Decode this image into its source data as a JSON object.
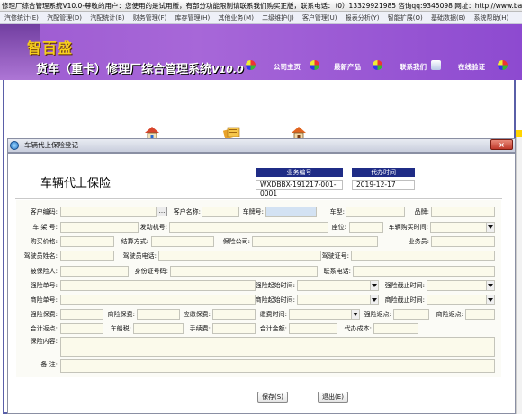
{
  "window": {
    "title": "修理厂综合管理系统V10.0-尊敬的用户：您使用的是试用版，有部分功能限制请联系我们购买正版，联系电话：（0）13329921985  咨询qq:9345098  网址：http://www.baishengsoft.com"
  },
  "menu": {
    "items": [
      "汽修统计(E)",
      "汽配管理(D)",
      "汽配统计(B)",
      "财务管理(F)",
      "库存管理(H)",
      "其他业务(M)",
      "二级维护(J)",
      "客户管理(U)",
      "报表分析(Y)",
      "智能扩展(O)",
      "基础数据(B)",
      "系统帮助(H)"
    ]
  },
  "banner": {
    "brand": "智百盛",
    "title": "货车（重卡）修理厂综合管理系统",
    "version": "V10.0",
    "links": [
      "公司主页",
      "最新产品",
      "联系我们",
      "在线验证"
    ],
    "colors": {
      "banner": "#9d5bd1",
      "brand": "#f6cf1e"
    }
  },
  "mdi_icons": [
    "house-icon",
    "document-stack-icon",
    "house-icon"
  ],
  "dialog": {
    "title": "车辆代上保险登记",
    "close_label": "×",
    "form_title": "车辆代上保险",
    "header": {
      "business_no_label": "业务编号",
      "business_no": "WXDBBX-191217-001-0001",
      "date_label": "代办时间",
      "date": "2019-12-17"
    },
    "fields": {
      "customer_code": "客户编码:",
      "customer_code_btn": "...",
      "customer_name": "客户名称:",
      "plate_no": "车牌号:",
      "car_type": "车型:",
      "brand": "品牌:",
      "vin": "车 架 号:",
      "engine_no": "发动机号:",
      "seats": "座位:",
      "purchase_date": "车辆购买时间:",
      "purchase_price": "购买价格:",
      "settlement": "结算方式:",
      "insurer": "保险公司:",
      "salesman": "业务员:",
      "driver_name": "驾驶员姓名:",
      "driver_phone": "驾驶员电话:",
      "driver_license": "驾驶证号:",
      "insured": "被保险人:",
      "id_no": "身份证号码:",
      "contact_phone": "联系电话:",
      "compulsory_policy_no": "强险单号:",
      "compulsory_start": "强险起始时间:",
      "compulsory_end": "强险截止时间:",
      "commercial_policy_no": "商险单号:",
      "commercial_start": "商险起始时间:",
      "commercial_end": "商险截止时间:",
      "compulsory_premium": "强险保费:",
      "commercial_premium": "商险保费:",
      "receivable_premium": "应缴保费:",
      "payment_time": "缴费时间:",
      "compulsory_rebate": "强险返点:",
      "commercial_rebate": "商险返点:",
      "total_rebate": "合计返点:",
      "vehicle_tax": "车船税:",
      "handling_fee": "手续费:",
      "total_amount": "合计金额:",
      "agency_cost": "代办成本:",
      "insurance_content": "保险内容:",
      "remarks": "备    注:"
    },
    "buttons": {
      "save": "保存(S)",
      "exit": "退出(E)"
    }
  }
}
